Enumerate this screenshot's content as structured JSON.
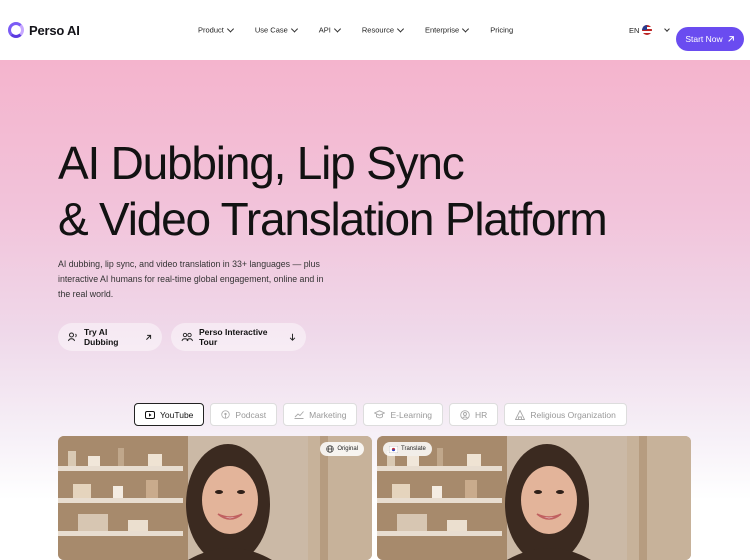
{
  "brand": {
    "name": "Perso AI"
  },
  "nav": {
    "items": [
      {
        "label": "Product",
        "has_menu": true
      },
      {
        "label": "Use Case",
        "has_menu": true
      },
      {
        "label": "API",
        "has_menu": true
      },
      {
        "label": "Resource",
        "has_menu": true
      },
      {
        "label": "Enterprise",
        "has_menu": true
      },
      {
        "label": "Pricing",
        "has_menu": false
      }
    ],
    "language": "EN",
    "cta_label": "Start Now"
  },
  "hero": {
    "title_line1": "AI Dubbing, Lip Sync",
    "title_line2": "& Video Translation Platform",
    "subtitle": "AI dubbing, lip sync, and video translation in 33+ languages — plus interactive AI humans for real-time global engagement, online and in the real world.",
    "buttons": [
      {
        "label": "Try AI Dubbing",
        "icon": "dubbing-icon"
      },
      {
        "label": "Perso Interactive Tour",
        "icon": "people-icon"
      }
    ]
  },
  "use_case_tabs": [
    {
      "label": "YouTube",
      "icon": "youtube-icon",
      "active": true
    },
    {
      "label": "Podcast",
      "icon": "podcast-icon",
      "active": false
    },
    {
      "label": "Marketing",
      "icon": "chart-icon",
      "active": false
    },
    {
      "label": "E-Learning",
      "icon": "graduation-icon",
      "active": false
    },
    {
      "label": "HR",
      "icon": "hr-icon",
      "active": false
    },
    {
      "label": "Religious Organization",
      "icon": "church-icon",
      "active": false
    }
  ],
  "videos": {
    "original_label": "Original",
    "translate_label": "Translate"
  },
  "colors": {
    "accent": "#6a4cf0",
    "hero_pink": "#f4b4cd"
  }
}
